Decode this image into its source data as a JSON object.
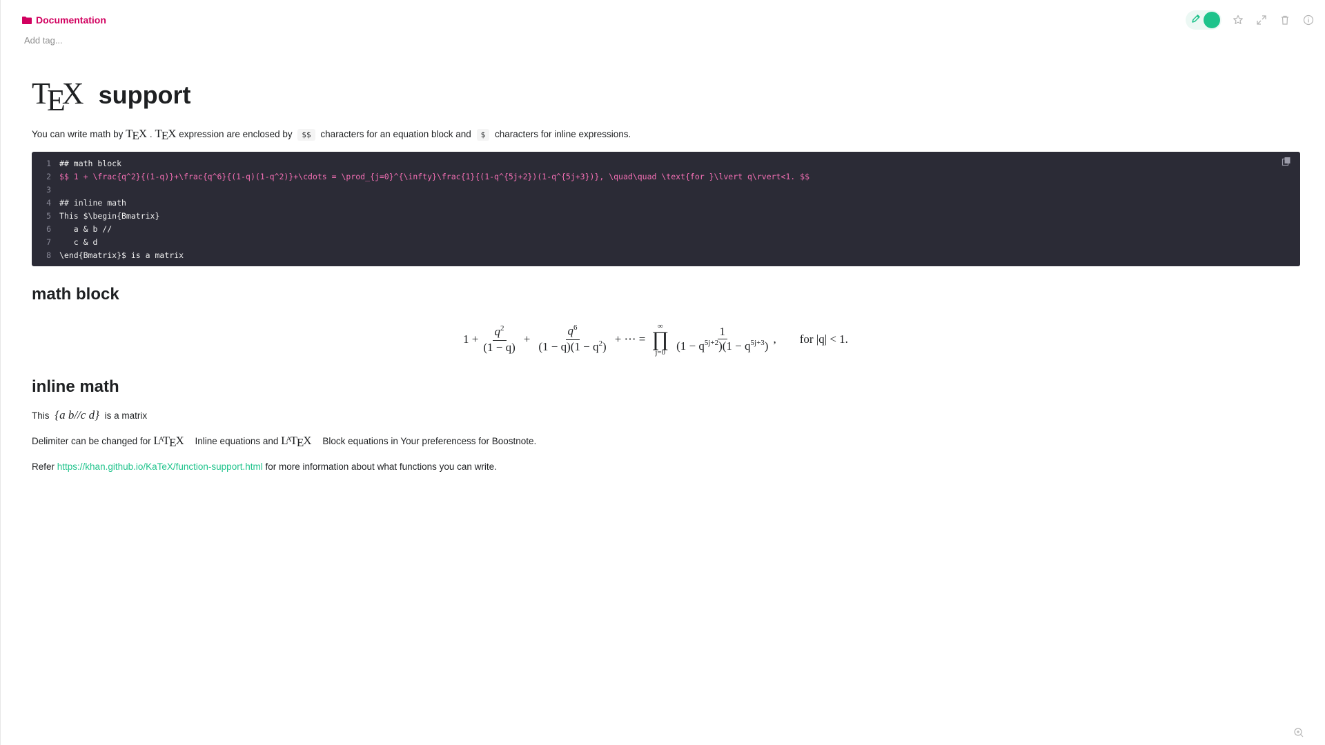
{
  "header": {
    "folder": "Documentation",
    "add_tag_placeholder": "Add tag..."
  },
  "toolbar": {
    "icons": [
      "pencil-icon",
      "star-icon",
      "fullscreen-icon",
      "trash-icon",
      "info-icon"
    ]
  },
  "title": {
    "logo": "TEX",
    "text": "support"
  },
  "intro": {
    "part1": "You can write math by",
    "logo1": "TEX",
    "dot": ".",
    "logo2": "TEX",
    "part2": "expression are enclosed by",
    "code1": "$$",
    "part3": "characters for an equation block and",
    "code2": "$",
    "part4": "characters for inline expressions."
  },
  "code": {
    "lines": [
      {
        "n": "1",
        "t": "## math block"
      },
      {
        "n": "2",
        "t": "$$ 1 + \\frac{q^2}{(1-q)}+\\frac{q^6}{(1-q)(1-q^2)}+\\cdots = \\prod_{j=0}^{\\infty}\\frac{1}{(1-q^{5j+2})(1-q^{5j+3})}, \\quad\\quad \\text{for }\\lvert q\\rvert<1. $$"
      },
      {
        "n": "3",
        "t": ""
      },
      {
        "n": "4",
        "t": "## inline math"
      },
      {
        "n": "5",
        "t": "This $\\begin{Bmatrix}"
      },
      {
        "n": "6",
        "t": "   a & b //"
      },
      {
        "n": "7",
        "t": "   c & d"
      },
      {
        "n": "8",
        "t": "\\end{Bmatrix}$ is a matrix"
      }
    ]
  },
  "section_math_block": {
    "heading": "math block"
  },
  "equation": {
    "one_plus": "1 +",
    "f1_num": "q",
    "f1_num_sup": "2",
    "f1_den": "(1 − q)",
    "plus2": "+",
    "f2_num": "q",
    "f2_num_sup": "6",
    "f2_den": "(1 − q)(1 − q",
    "f2_den_sup": "2",
    "f2_den_close": ")",
    "cdots": "+ ⋯ =",
    "prod_top": "∞",
    "prod_sym": "∏",
    "prod_bottom": "j=0",
    "f3_num": "1",
    "f3_den_a": "(1 − q",
    "f3_den_sup1": "5j+2",
    "f3_den_b": ")(1 − q",
    "f3_den_sup2": "5j+3",
    "f3_den_c": ")",
    "comma": ",",
    "for_text": "for |q| < 1."
  },
  "section_inline": {
    "heading": "inline math",
    "this": "This",
    "matrix": "{a   b//c   d}",
    "rest": "is a matrix"
  },
  "delimiter": {
    "part1": "Delimiter can be changed for",
    "logo1": "LATEX",
    "part2": "Inline equations and",
    "logo2": "LATEX",
    "part3": "Block equations in Your preferencess for Boostnote."
  },
  "refer": {
    "part1": "Refer",
    "link": "https://khan.github.io/KaTeX/function-support.html",
    "part2": "for more information about what functions you can write."
  },
  "colors": {
    "accent": "#1ec38b",
    "folder": "#d1005f",
    "code_bg": "#2b2b36"
  }
}
